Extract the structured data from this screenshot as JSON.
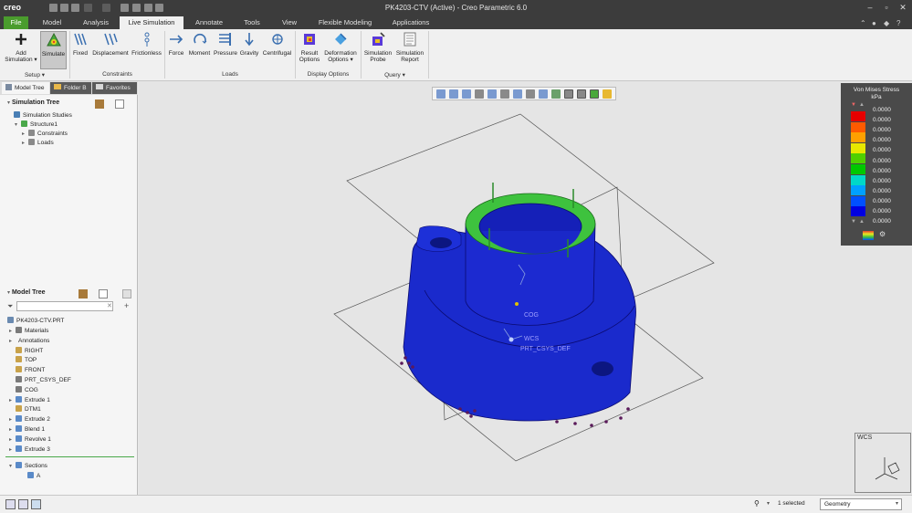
{
  "app": {
    "logo": "creo",
    "title": "PK4203-CTV (Active) - Creo Parametric 6.0"
  },
  "tabs": [
    "File",
    "Model",
    "Analysis",
    "Live Simulation",
    "Annotate",
    "Tools",
    "View",
    "Flexible Modeling",
    "Applications"
  ],
  "active_tab": "Live Simulation",
  "ribbon": {
    "add_simulation": [
      "Add",
      "Simulation ▾"
    ],
    "simulate": "Simulate",
    "fixed": "Fixed",
    "displacement": "Displacement",
    "frictionless": "Frictionless",
    "force": "Force",
    "moment": "Moment",
    "pressure": "Pressure",
    "gravity": "Gravity",
    "centrifugal": "Centrifugal",
    "result_options": [
      "Result",
      "Options"
    ],
    "deformation_options": [
      "Deformation",
      "Options ▾"
    ],
    "simulation_probe": [
      "Simulation",
      "Probe"
    ],
    "simulation_report": [
      "Simulation",
      "Report"
    ],
    "groups": {
      "setup": "Setup ▾",
      "constraints": "Constraints",
      "loads": "Loads",
      "display_options": "Display Options",
      "query": "Query ▾"
    }
  },
  "nav_tabs": [
    "Model Tree",
    "Folder B",
    "Favorites"
  ],
  "simulation_tree": {
    "title": "Simulation Tree",
    "items": [
      {
        "label": "Simulation Studies",
        "indent": 0,
        "expander": "",
        "icon_color": "#4a7fb5"
      },
      {
        "label": "Structure1",
        "indent": 1,
        "expander": "▾",
        "icon_color": "#4aa84a"
      },
      {
        "label": "Constraints",
        "indent": 2,
        "expander": "▸",
        "icon_color": "#8a8a8a"
      },
      {
        "label": "Loads",
        "indent": 2,
        "expander": "▸",
        "icon_color": "#8a8a8a"
      }
    ]
  },
  "model_tree": {
    "title": "Model Tree",
    "root": "PK4203-CTV.PRT",
    "items": [
      {
        "label": "Materials",
        "expander": "▸",
        "icon_color": "#7a7a7a"
      },
      {
        "label": "Annotations",
        "expander": "▸",
        "icon_color": ""
      },
      {
        "label": "RIGHT",
        "expander": "",
        "icon_color": "#c8a24a"
      },
      {
        "label": "TOP",
        "expander": "",
        "icon_color": "#c8a24a"
      },
      {
        "label": "FRONT",
        "expander": "",
        "icon_color": "#c8a24a"
      },
      {
        "label": "PRT_CSYS_DEF",
        "expander": "",
        "icon_color": "#7a7a7a"
      },
      {
        "label": "COG",
        "expander": "",
        "icon_color": "#7a7a7a"
      },
      {
        "label": "Extrude 1",
        "expander": "▸",
        "icon_color": "#5a8ac8"
      },
      {
        "label": "DTM1",
        "expander": "",
        "icon_color": "#c8a24a"
      },
      {
        "label": "Extrude 2",
        "expander": "▸",
        "icon_color": "#5a8ac8"
      },
      {
        "label": "Blend 1",
        "expander": "▸",
        "icon_color": "#5a8ac8"
      },
      {
        "label": "Revolve 1",
        "expander": "▸",
        "icon_color": "#5a8ac8"
      },
      {
        "label": "Extrude 3",
        "expander": "▸",
        "icon_color": "#5a8ac8"
      }
    ],
    "sections_label": "Sections",
    "sections_item": "A"
  },
  "legend": {
    "title": "Von Mises Stress",
    "unit": "kPa",
    "colors": [
      "#e60000",
      "#ff5a00",
      "#ffa000",
      "#e8e800",
      "#50d000",
      "#00c800",
      "#00d8c8",
      "#00a0ff",
      "#0050ff",
      "#0000e0"
    ],
    "values": [
      "0.0000",
      "0.0000",
      "0.0000",
      "0.0000",
      "0.0000",
      "0.0000",
      "0.0000",
      "0.0000",
      "0.0000",
      "0.0000",
      "0.0000",
      "0.0000"
    ]
  },
  "viewport_labels": {
    "wcs_inset": "WCS",
    "cog": "COG",
    "wcs": "WCS",
    "prt_csys": "PRT_CSYS_DEF"
  },
  "status": {
    "selected": "1 selected",
    "filter_value": "Geometry"
  }
}
